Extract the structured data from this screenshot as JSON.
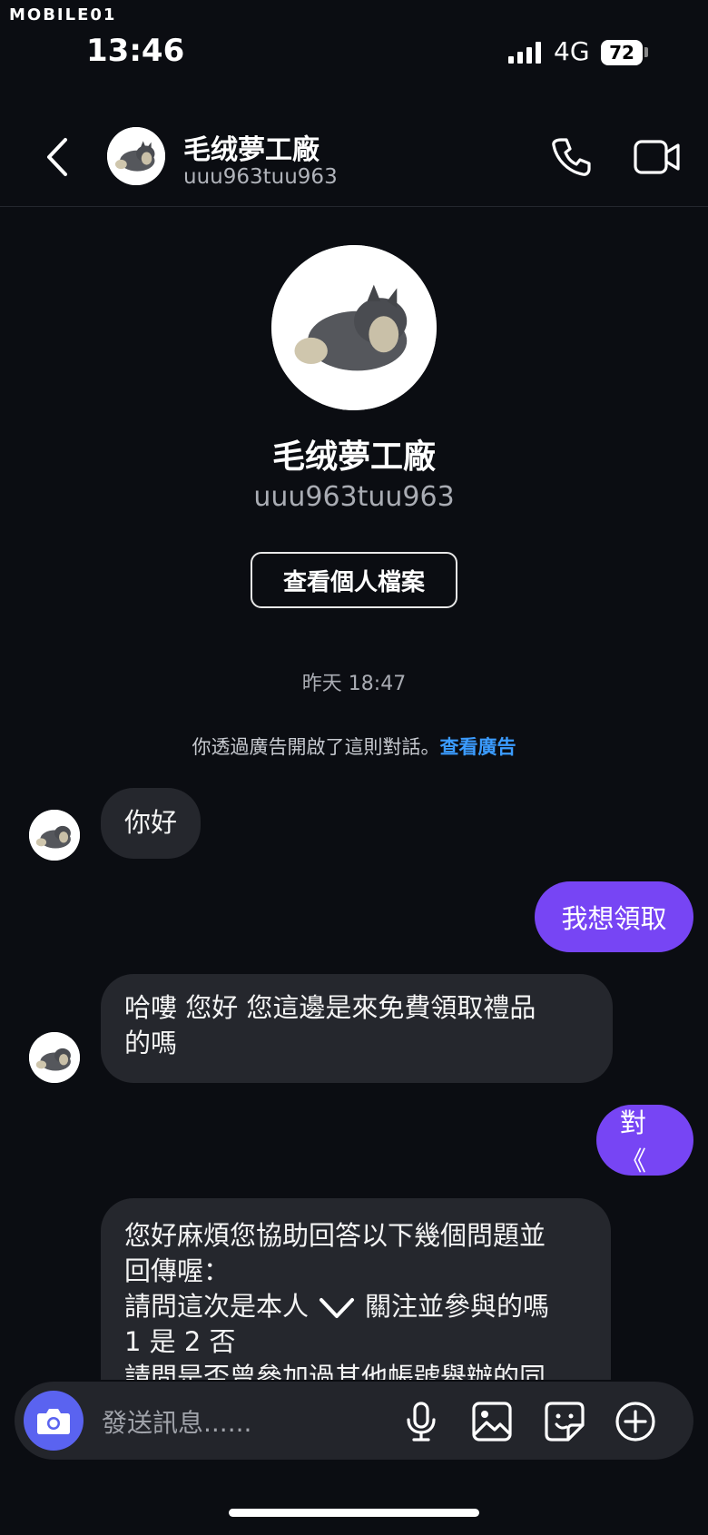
{
  "watermark": "MOBILE01",
  "status": {
    "time": "13:46",
    "network": "4G",
    "battery": "72"
  },
  "header": {
    "name": "毛绒夢工廠",
    "username": "uuu963tuu963"
  },
  "profile": {
    "name": "毛绒夢工廠",
    "username": "uuu963tuu963",
    "view_button": "查看個人檔案"
  },
  "chat": {
    "timestamp": "昨天 18:47",
    "notice_text": "你透過廣告開啟了這則對話。",
    "notice_link": "查看廣告",
    "messages": [
      {
        "from": "them",
        "text": "你好"
      },
      {
        "from": "me",
        "text": "我想領取"
      },
      {
        "from": "them",
        "line1": "哈嘍  您好   您這邊是來免費領取禮品",
        "line2": "的嗎"
      },
      {
        "from": "me",
        "text": "對《"
      },
      {
        "from": "them",
        "line1": "您好麻煩您協助回答以下幾個問題並",
        "line2": "回傳喔：",
        "line3_a": "請問這次是本人",
        "line3_b": "關注並參與的嗎",
        "line4": "1 是 2 否",
        "line5": "請問是否曾參加過其他帳號舉辦的同"
      }
    ]
  },
  "composer": {
    "placeholder": "發送訊息......"
  },
  "colors": {
    "accent": "#7745f4",
    "link": "#3b9cff",
    "bubble_in": "#25272d",
    "camera": "#5a63f0"
  }
}
